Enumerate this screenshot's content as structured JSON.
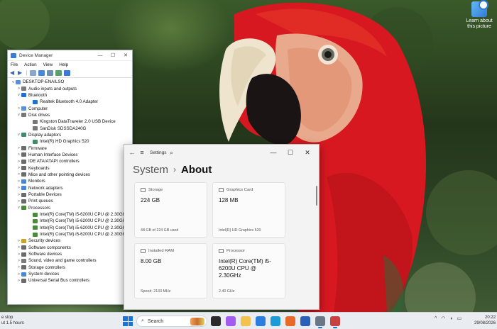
{
  "desktop": {
    "icon_label": "Learn about this picture",
    "icon_name": "learn-about-picture-icon"
  },
  "device_manager": {
    "title": "Device Manager",
    "window_controls": [
      "—",
      "☐",
      "✕"
    ],
    "menu": [
      "File",
      "Action",
      "View",
      "Help"
    ],
    "toolbar_icons": [
      "back-arrow-icon",
      "forward-arrow-icon",
      "properties-icon",
      "help-icon",
      "update-driver-icon",
      "scan-icon",
      "monitor-icon"
    ],
    "tree": [
      {
        "level": 0,
        "expander": "v",
        "label": "DESKTOP-ENAILSO",
        "color": "#5a8fd8"
      },
      {
        "level": 1,
        "expander": ">",
        "label": "Audio inputs and outputs",
        "color": "#7a7a7a"
      },
      {
        "level": 1,
        "expander": "v",
        "label": "Bluetooth",
        "color": "#1f6fd6"
      },
      {
        "level": 2,
        "expander": "",
        "label": "Realtek Bluetooth 4.0 Adapter",
        "color": "#1f6fd6"
      },
      {
        "level": 1,
        "expander": ">",
        "label": "Computer",
        "color": "#5a8fd8"
      },
      {
        "level": 1,
        "expander": "v",
        "label": "Disk drives",
        "color": "#777777"
      },
      {
        "level": 2,
        "expander": "",
        "label": "Kingston DataTraveler 2.0 USB Device",
        "color": "#777777"
      },
      {
        "level": 2,
        "expander": "",
        "label": "SanDisk SDSSDA240G",
        "color": "#777777"
      },
      {
        "level": 1,
        "expander": "v",
        "label": "Display adaptors",
        "color": "#3f8c6a"
      },
      {
        "level": 2,
        "expander": "",
        "label": "Intel(R) HD Graphics 520",
        "color": "#3f8c6a"
      },
      {
        "level": 1,
        "expander": ">",
        "label": "Firmware",
        "color": "#6b6b6b"
      },
      {
        "level": 1,
        "expander": ">",
        "label": "Human Interface Devices",
        "color": "#6b6b6b"
      },
      {
        "level": 1,
        "expander": ">",
        "label": "IDE ATA/ATAPI controllers",
        "color": "#6b6b6b"
      },
      {
        "level": 1,
        "expander": ">",
        "label": "Keyboards",
        "color": "#6b6b6b"
      },
      {
        "level": 1,
        "expander": ">",
        "label": "Mice and other pointing devices",
        "color": "#6b6b6b"
      },
      {
        "level": 1,
        "expander": ">",
        "label": "Monitors",
        "color": "#4a86d6"
      },
      {
        "level": 1,
        "expander": ">",
        "label": "Network adapters",
        "color": "#4a86d6"
      },
      {
        "level": 1,
        "expander": ">",
        "label": "Portable Devices",
        "color": "#6b6b6b"
      },
      {
        "level": 1,
        "expander": ">",
        "label": "Print queues",
        "color": "#6b6b6b"
      },
      {
        "level": 1,
        "expander": "v",
        "label": "Processors",
        "color": "#4a8a3a"
      },
      {
        "level": 2,
        "expander": "",
        "label": "Intel(R) Core(TM) i5-6200U CPU @ 2.30GHz",
        "color": "#4a8a3a"
      },
      {
        "level": 2,
        "expander": "",
        "label": "Intel(R) Core(TM) i5-6200U CPU @ 2.30GHz",
        "color": "#4a8a3a"
      },
      {
        "level": 2,
        "expander": "",
        "label": "Intel(R) Core(TM) i5-6200U CPU @ 2.30GHz",
        "color": "#4a8a3a"
      },
      {
        "level": 2,
        "expander": "",
        "label": "Intel(R) Core(TM) i5-6200U CPU @ 2.30GHz",
        "color": "#4a8a3a"
      },
      {
        "level": 1,
        "expander": ">",
        "label": "Security devices",
        "color": "#c9a227"
      },
      {
        "level": 1,
        "expander": ">",
        "label": "Software components",
        "color": "#6b6b6b"
      },
      {
        "level": 1,
        "expander": ">",
        "label": "Software devices",
        "color": "#6b6b6b"
      },
      {
        "level": 1,
        "expander": ">",
        "label": "Sound, video and game controllers",
        "color": "#7a7a7a"
      },
      {
        "level": 1,
        "expander": ">",
        "label": "Storage controllers",
        "color": "#6b6b6b"
      },
      {
        "level": 1,
        "expander": ">",
        "label": "System devices",
        "color": "#4a86d6"
      },
      {
        "level": 1,
        "expander": ">",
        "label": "Universal Serial Bus controllers",
        "color": "#6b6b6b"
      }
    ]
  },
  "settings": {
    "app_title": "Settings",
    "back_icon": "←",
    "menu_icon": "≡",
    "search_icon": "⌕",
    "window_controls": [
      "—",
      "☐",
      "✕"
    ],
    "breadcrumb": {
      "parent": "System",
      "separator": "›",
      "current": "About"
    },
    "cards": [
      {
        "key": "storage",
        "label": "Storage",
        "value": "224 GB",
        "sub": "48 GB of 224 GB used"
      },
      {
        "key": "graphics",
        "label": "Graphics Card",
        "value": "128 MB",
        "sub": "Intel(R) HD Graphics 520"
      },
      {
        "key": "ram",
        "label": "Installed RAM",
        "value": "8.00 GB",
        "sub": "Speed: 2133 MHz"
      },
      {
        "key": "processor",
        "label": "Processor",
        "value": "Intel(R) Core(TM) i5-6200U CPU @ 2.30GHz",
        "sub": "2.40 GHz"
      }
    ]
  },
  "taskbar": {
    "weather_line1": "e stop",
    "weather_line2": "ut 1.5 hours",
    "search_placeholder": "Search",
    "apps": [
      {
        "name": "task-view-icon",
        "color": "#2b2b2b"
      },
      {
        "name": "copilot-icon",
        "color": "#a45cf0"
      },
      {
        "name": "file-explorer-icon",
        "color": "#f2c14e"
      },
      {
        "name": "microsoft-store-icon",
        "color": "#2b7de0"
      },
      {
        "name": "edge-icon",
        "color": "#1d9bd7"
      },
      {
        "name": "firefox-icon",
        "color": "#e86a2a"
      },
      {
        "name": "word-icon",
        "color": "#2b5fb8"
      },
      {
        "name": "settings-icon",
        "color": "#6b7787"
      },
      {
        "name": "device-manager-icon",
        "color": "#c84040"
      }
    ],
    "tray": {
      "chevron": "^",
      "wifi": "wifi-icon",
      "volume": "volume-icon",
      "battery": "battery-icon"
    },
    "time": "20:22",
    "date": "29/08/2026"
  }
}
